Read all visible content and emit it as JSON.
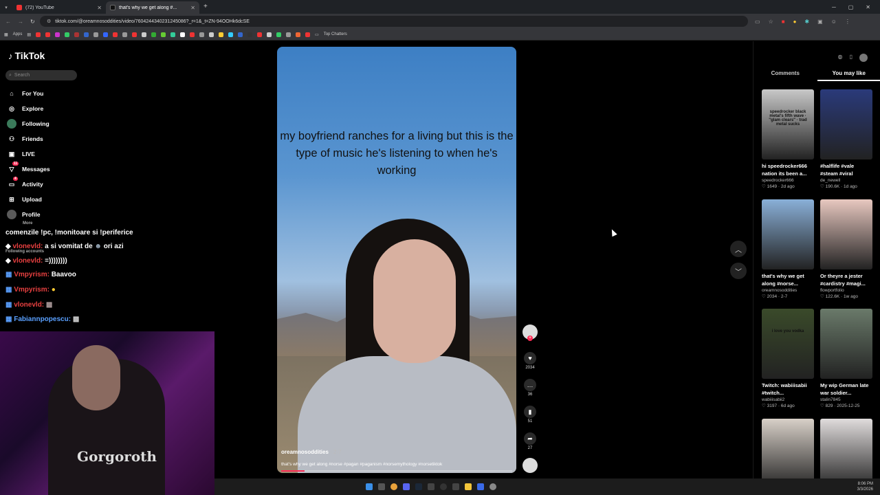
{
  "browser": {
    "tabs": [
      {
        "title": "(72) YouTube"
      },
      {
        "title": "that's why we get along #..."
      }
    ],
    "new_tab_icon": "plus-icon",
    "url": "tiktok.com/@oreamnosoddities/video/7604244340231245086?_r=1&_t=ZN-94OOHk6dcSE",
    "bookmarks_apps": "Apps",
    "bookmarks_folder": "Top Chatters"
  },
  "sidebar": {
    "logo": "TikTok",
    "search_placeholder": "Search",
    "items": [
      {
        "label": "For You",
        "icon": "home-icon",
        "color": "#2a2a2a"
      },
      {
        "label": "Explore",
        "icon": "compass-icon",
        "color": "#2a2a2a"
      },
      {
        "label": "Following",
        "icon": "following-avatar-icon",
        "color": "#3a7a5a"
      },
      {
        "label": "Friends",
        "icon": "friends-icon",
        "color": "#2a2a2a"
      },
      {
        "label": "LIVE",
        "icon": "live-icon",
        "color": "#2a2a2a"
      },
      {
        "label": "Messages",
        "icon": "messages-icon",
        "color": "#2a2a2a"
      },
      {
        "label": "Activity",
        "icon": "activity-icon",
        "color": "#2a2a2a"
      },
      {
        "label": "Upload",
        "icon": "upload-icon",
        "color": "#2a2a2a"
      },
      {
        "label": "Profile",
        "icon": "profile-avatar-icon",
        "color": "#5a5a5a"
      }
    ],
    "messages_badge": "11",
    "activity_badge": "4"
  },
  "chat": {
    "lines": [
      {
        "text": "comenzile !pc, !monitoare si !periferice"
      },
      {
        "user": "vlonevld:",
        "text": "a si vomitat de",
        "extra": "ori azi"
      },
      {
        "user": "vlonevld:",
        "text": "=))))))))"
      },
      {
        "user": "Vmpyrism:",
        "text": "Baavoo"
      },
      {
        "user": "Vmpyrism:",
        "text": ""
      },
      {
        "user": "vlonevld:",
        "text": ""
      },
      {
        "user": "Fabiannpopescu:",
        "text": ""
      }
    ],
    "overlay_more": "More",
    "overlay_following": "Following accounts"
  },
  "webcam": {
    "shirt_text": "Gorgoroth"
  },
  "video": {
    "caption": "my boyfriend ranches for a living but this is the type of music he's listening to when he's working",
    "author": "oreamnosoddities",
    "date": "· 2-7",
    "description": "that's why we get along #norse #pagan #paganism #norsemythology #norsetiktok",
    "progress": 0.1
  },
  "actions": {
    "likes": "2034",
    "comments": "36",
    "saves": "51",
    "shares": "27"
  },
  "right_panel": {
    "tabs": [
      {
        "label": "Comments"
      },
      {
        "label": "You may like"
      }
    ],
    "cards": [
      {
        "title": "hi speedrocker666 nation its been a...",
        "user": "speedrocker666",
        "likes": "1649",
        "date": "2d ago",
        "thumb_text": "speedrocker black metal's fifth wave · \"glam clears\" · trad metal sucks",
        "color": "#c8c8c8"
      },
      {
        "title": "#halflife #vale #steam #viral",
        "user": "de_newell",
        "likes": "190.6K",
        "date": "1d ago",
        "thumb_text": "",
        "color": "#2a3a7a"
      },
      {
        "title": "that's why we get along #norse...",
        "user": "oreamnosoddities",
        "likes": "2034",
        "date": "2-7",
        "thumb_text": "",
        "color": "#8ab0d8"
      },
      {
        "title": "Or theyre a jester #cardistry #magi...",
        "user": "flowportfolio",
        "likes": "122.6K",
        "date": "1w ago",
        "thumb_text": "",
        "color": "#e8c8c0"
      },
      {
        "title": "Twitch: wabiiisabii #twitch...",
        "user": "wabiiisabii2",
        "likes": "3197",
        "date": "6d ago",
        "thumb_text": "i love you vodka",
        "color": "#3a4a2a"
      },
      {
        "title": "My wip German late war soldier...",
        "user": "stalin7845",
        "likes": "829",
        "date": "2025-12-25",
        "thumb_text": "",
        "color": "#6a7a6a"
      },
      {
        "title": "",
        "user": "",
        "likes": "",
        "date": "",
        "thumb_text": "",
        "color": "#d8d0c8"
      },
      {
        "title": "",
        "user": "",
        "likes": "",
        "date": "",
        "thumb_text": "",
        "color": "#e0dcdc"
      }
    ]
  },
  "taskbar": {
    "time": "8:06 PM",
    "date": "3/3/2026"
  }
}
